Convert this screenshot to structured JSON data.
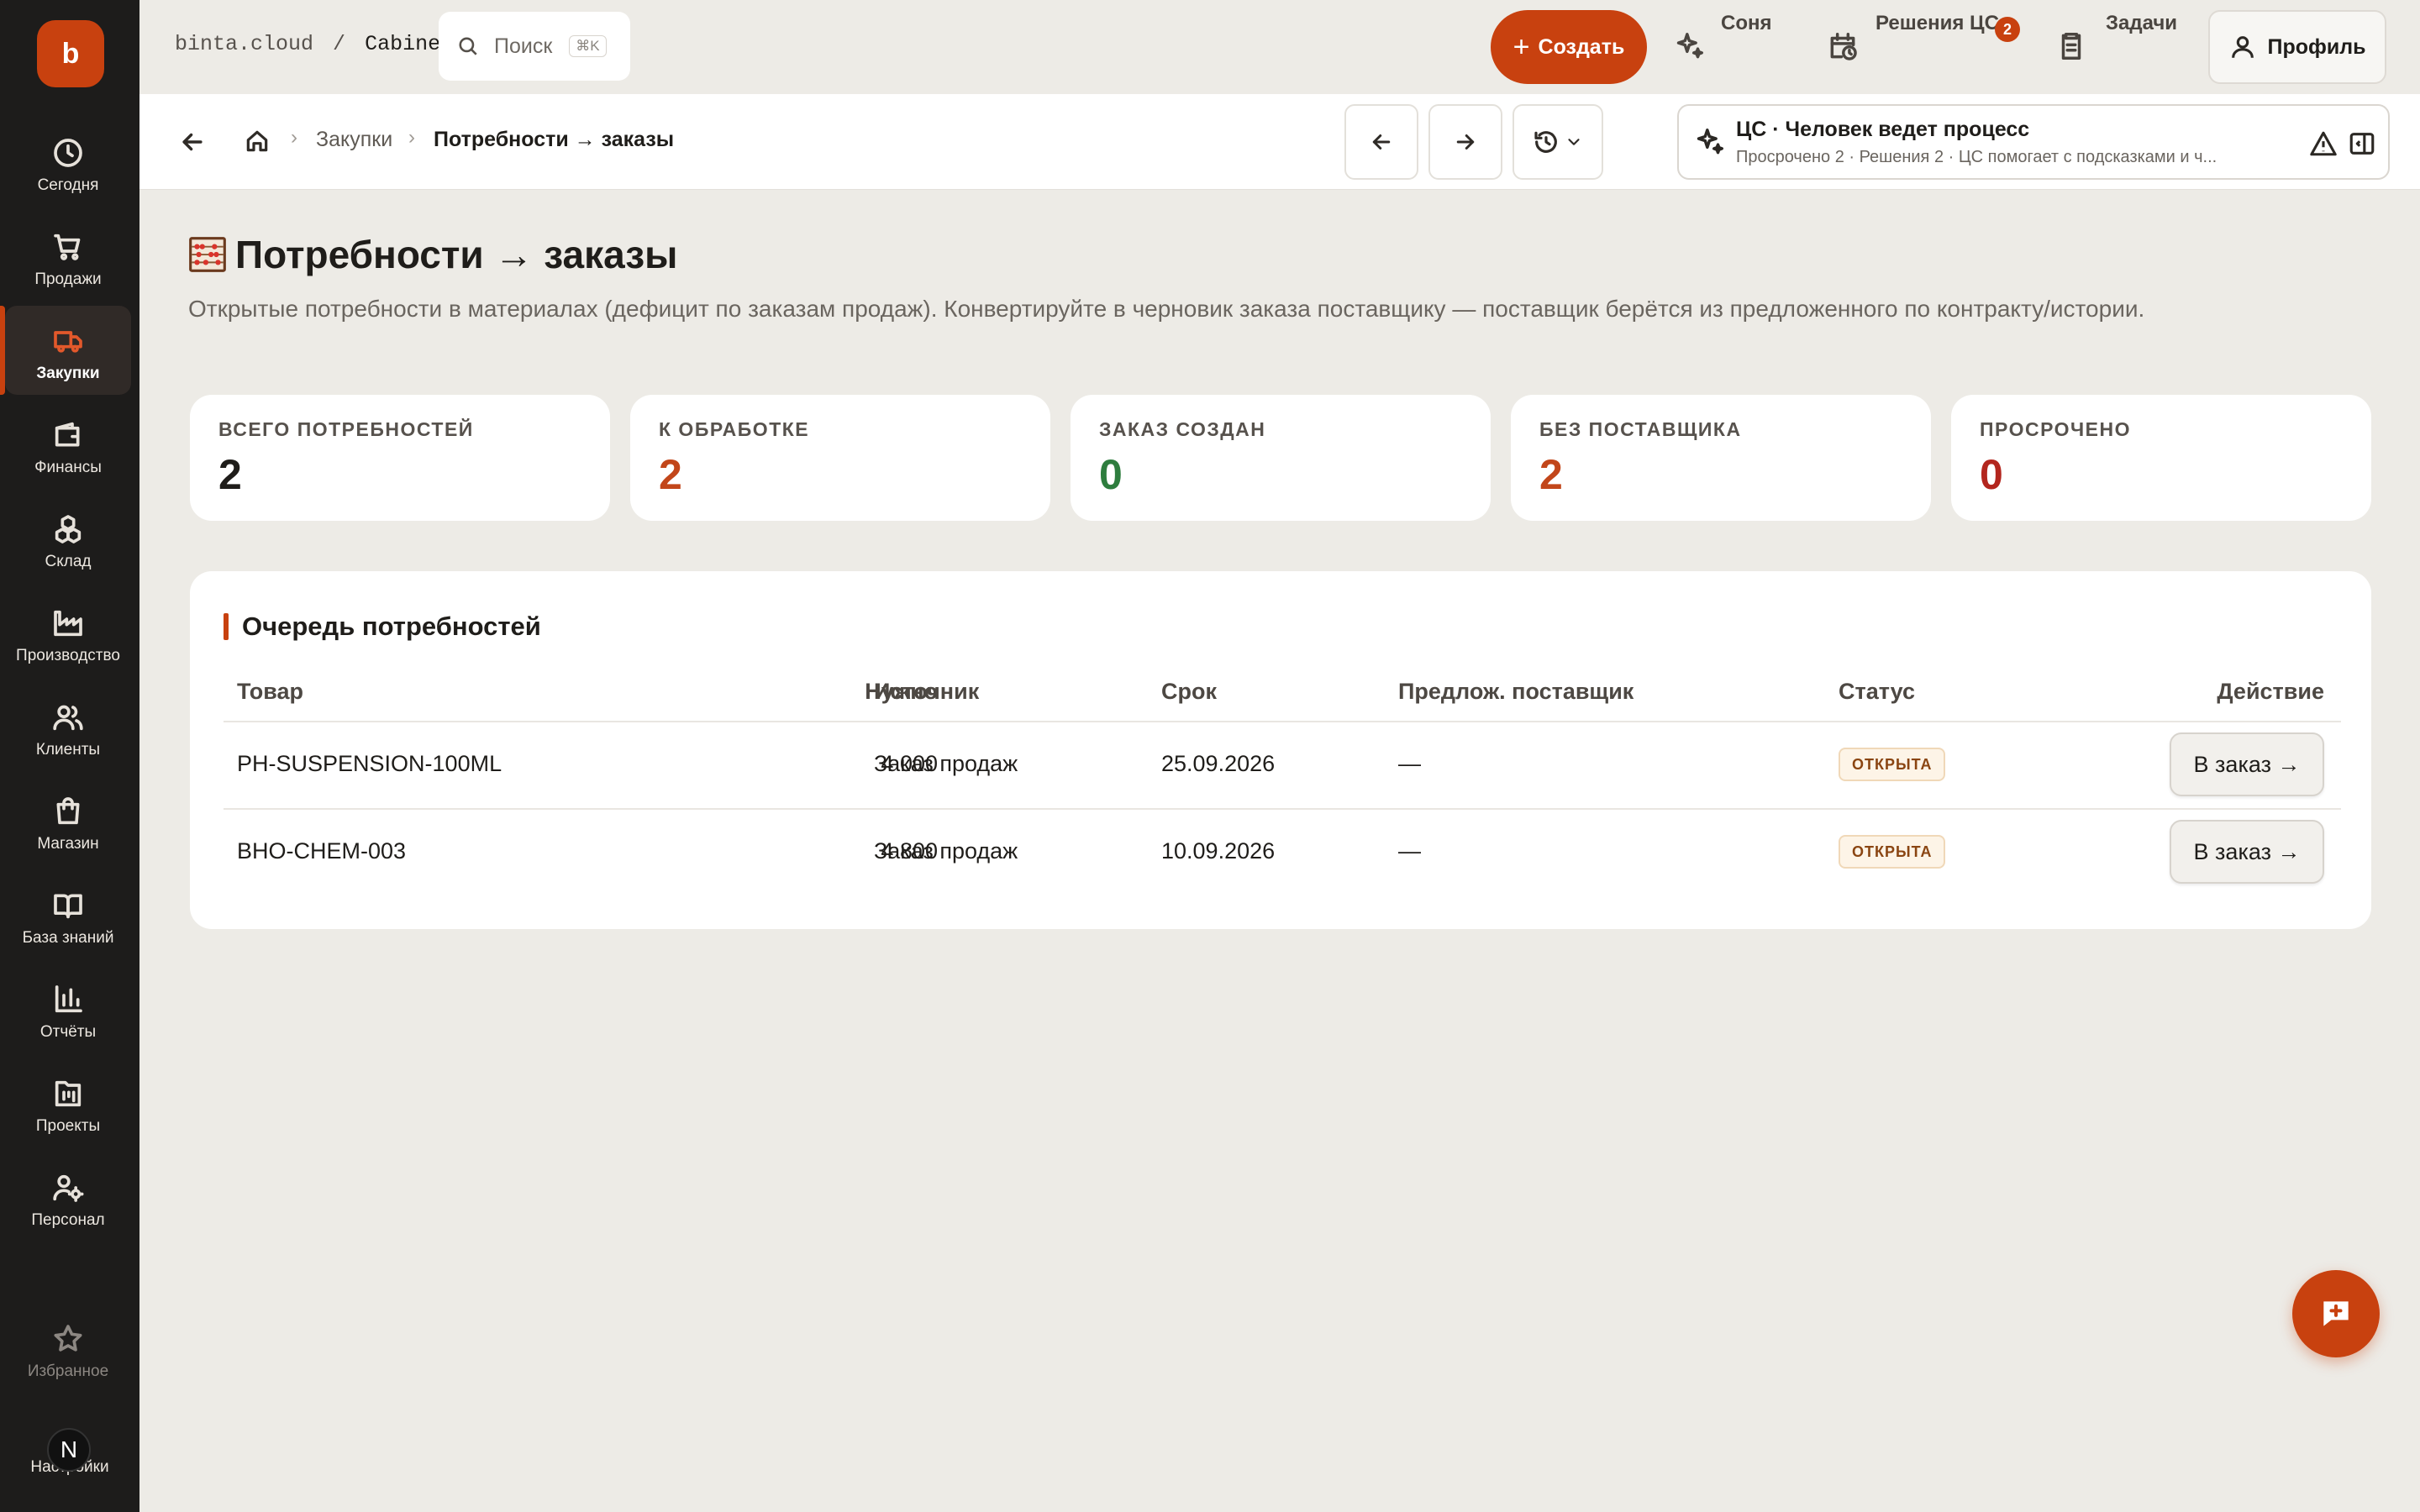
{
  "app": {
    "logo_letter": "b",
    "accent": "#c8410f"
  },
  "sidebar": {
    "items": [
      {
        "label": "Сегодня",
        "icon": "clock-icon"
      },
      {
        "label": "Продажи",
        "icon": "cart-icon"
      },
      {
        "label": "Закупки",
        "icon": "truck-icon",
        "active": true
      },
      {
        "label": "Финансы",
        "icon": "wallet-icon"
      },
      {
        "label": "Склад",
        "icon": "boxes-icon"
      },
      {
        "label": "Производство",
        "icon": "factory-icon"
      },
      {
        "label": "Клиенты",
        "icon": "users-icon"
      },
      {
        "label": "Магазин",
        "icon": "shopping-bag-icon"
      },
      {
        "label": "База знаний",
        "icon": "book-icon"
      },
      {
        "label": "Отчёты",
        "icon": "bar-chart-icon"
      },
      {
        "label": "Проекты",
        "icon": "kanban-icon"
      },
      {
        "label": "Персонал",
        "icon": "user-cog-icon"
      }
    ],
    "favorites_label": "Избранное",
    "settings_label": "Настройки",
    "avatar_letter": "N"
  },
  "topbar": {
    "host": "binta.cloud",
    "separator": "/",
    "workspace": "Cabinet",
    "search_placeholder": "Поиск",
    "search_shortcut": "⌘K",
    "create_label": "Создать",
    "sonya_label": "Соня",
    "decisions_label": "Решения ЦС",
    "decisions_badge": "2",
    "tasks_label": "Задачи",
    "profile_label": "Профиль"
  },
  "subbar": {
    "breadcrumb_parent": "Закупки",
    "breadcrumb_current": "Потребности → заказы",
    "cs_title": "ЦС · Человек ведет процесс",
    "cs_subtitle": "Просрочено 2 · Решения 2 · ЦС помогает с подсказками и ч..."
  },
  "page": {
    "title": "Потребности → заказы",
    "description": "Открытые потребности в материалах (дефицит по заказам продаж). Конвертируйте в черновик заказа поставщику — поставщик берётся из предложенного по контракту/истории."
  },
  "stats": [
    {
      "label": "ВСЕГО ПОТРЕБНОСТЕЙ",
      "value": "2",
      "color": "#1f1d1a"
    },
    {
      "label": "К ОБРАБОТКЕ",
      "value": "2",
      "color": "#c2461a"
    },
    {
      "label": "ЗАКАЗ СОЗДАН",
      "value": "0",
      "color": "#2e7d3e"
    },
    {
      "label": "БЕЗ ПОСТАВЩИКА",
      "value": "2",
      "color": "#c2461a"
    },
    {
      "label": "ПРОСРОЧЕНО",
      "value": "0",
      "color": "#b3261e"
    }
  ],
  "queue": {
    "title": "Очередь потребностей",
    "columns": {
      "product": "Товар",
      "needed": "Нужно",
      "source": "Источник",
      "due": "Срок",
      "supplier": "Предлож. поставщик",
      "status": "Статус",
      "action": "Действие"
    },
    "rows": [
      {
        "product": "PH-SUSPENSION-100ML",
        "needed": "4 000",
        "source": "Заказ продаж",
        "due": "25.09.2026",
        "supplier": "—",
        "status": "ОТКРЫТА",
        "action": "В заказ →"
      },
      {
        "product": "BHO-CHEM-003",
        "needed": "4 800",
        "source": "Заказ продаж",
        "due": "10.09.2026",
        "supplier": "—",
        "status": "ОТКРЫТА",
        "action": "В заказ →"
      }
    ]
  }
}
